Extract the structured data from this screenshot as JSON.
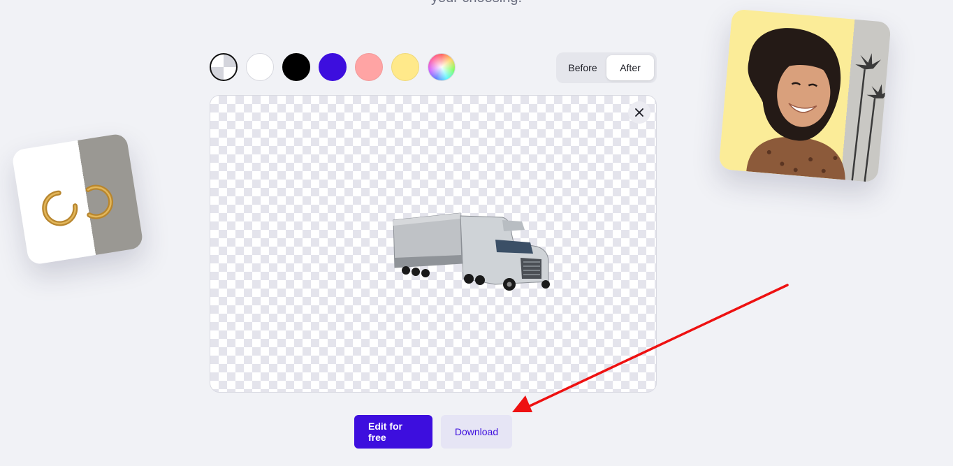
{
  "header": {
    "subtitle": "your choosing."
  },
  "background_swatches": [
    {
      "name": "transparent",
      "color": "transparent"
    },
    {
      "name": "white",
      "color": "#ffffff"
    },
    {
      "name": "black",
      "color": "#000000"
    },
    {
      "name": "purple",
      "color": "#3d0ede"
    },
    {
      "name": "pink",
      "color": "#ffa4a4"
    },
    {
      "name": "yellow",
      "color": "#ffe98a"
    },
    {
      "name": "custom",
      "color": "rainbow"
    }
  ],
  "view_toggle": {
    "before_label": "Before",
    "after_label": "After",
    "active": "After"
  },
  "canvas": {
    "close_icon": "close-icon",
    "image_subject": "truck"
  },
  "actions": {
    "edit_label": "Edit for free",
    "download_label": "Download"
  },
  "colors": {
    "brand": "#3d0ede",
    "brand_soft": "#e6e5f5",
    "page_bg": "#f1f2f6",
    "annotation_arrow": "#ee1111"
  }
}
